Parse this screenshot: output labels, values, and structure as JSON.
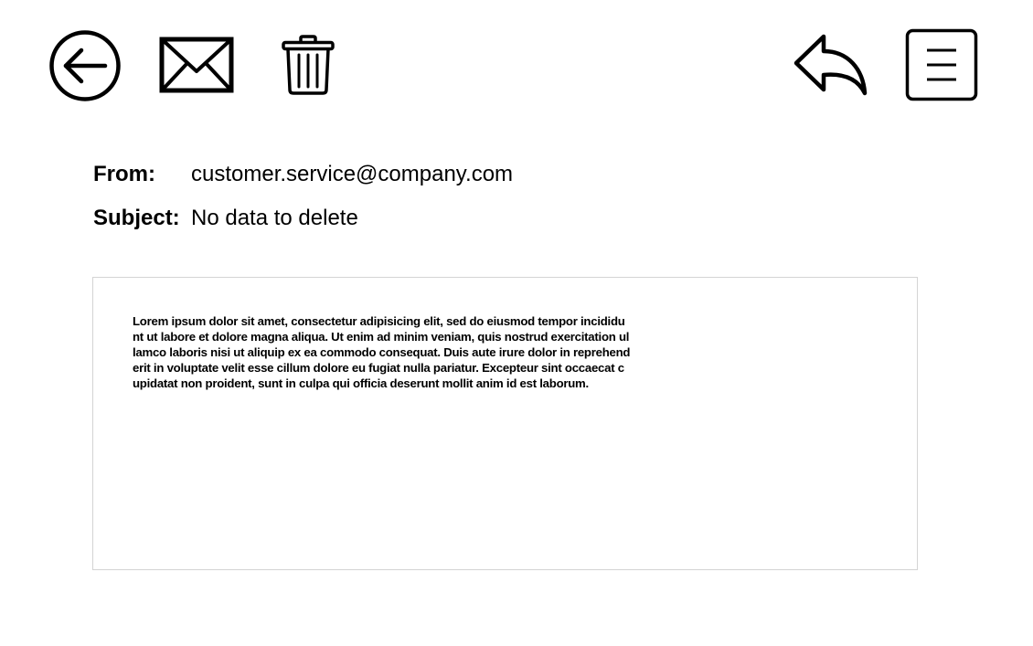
{
  "toolbar": {
    "back_icon": "arrow-left-circle-icon",
    "mail_icon": "envelope-icon",
    "delete_icon": "trash-icon",
    "reply_icon": "reply-arrow-icon",
    "menu_icon": "hamburger-menu-icon"
  },
  "email": {
    "from_label": "From:",
    "from_value": "customer.service@company.com",
    "subject_label": "Subject:",
    "subject_value": "No data to delete",
    "body": "Lorem ipsum dolor sit amet, consectetur adipisicing elit, sed do eiusmod tempor incididunt ut labore et dolore magna aliqua. Ut enim ad minim veniam, quis nostrud exercitation ullamco laboris nisi ut aliquip ex ea commodo consequat. Duis aute irure dolor in reprehenderit in voluptate velit esse cillum dolore eu fugiat nulla pariatur. Excepteur sint occaecat cupidatat non proident, sunt in culpa qui officia deserunt mollit anim id est laborum."
  }
}
